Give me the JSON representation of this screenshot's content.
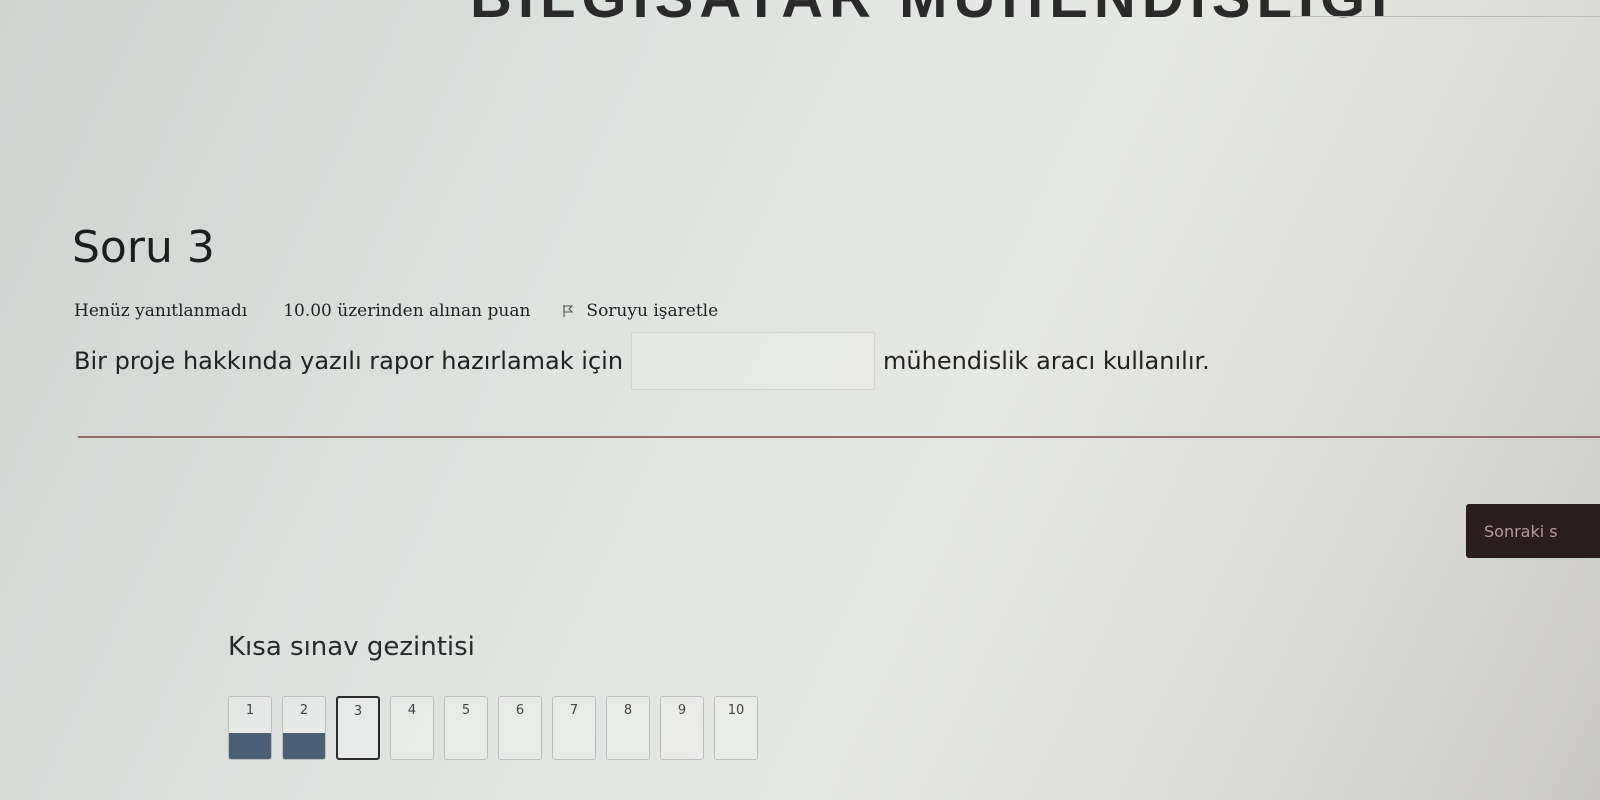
{
  "header": {
    "banner_text": "BİLGİSAYAR MÜHENDİSLİĞİ"
  },
  "question": {
    "title": "Soru 3",
    "status": "Henüz yanıtlanmadı",
    "grade": "10.00 üzerinden alınan puan",
    "flag_label": "Soruyu işaretle",
    "flag_icon": "flag-icon",
    "text_before": "Bir proje hakkında yazılı rapor hazırlamak için",
    "answer_value": "",
    "text_after": "mühendislik aracı kullanılır."
  },
  "next_button": {
    "label": "Sonraki s"
  },
  "quiz_nav": {
    "title": "Kısa sınav gezintisi",
    "answered_color": "#4a5f76",
    "buttons": [
      {
        "label": "1",
        "answered": true
      },
      {
        "label": "2",
        "answered": true
      },
      {
        "label": "3",
        "current": true
      },
      {
        "label": "4"
      },
      {
        "label": "5"
      },
      {
        "label": "6"
      },
      {
        "label": "7"
      },
      {
        "label": "8"
      },
      {
        "label": "9"
      },
      {
        "label": "10"
      }
    ]
  }
}
